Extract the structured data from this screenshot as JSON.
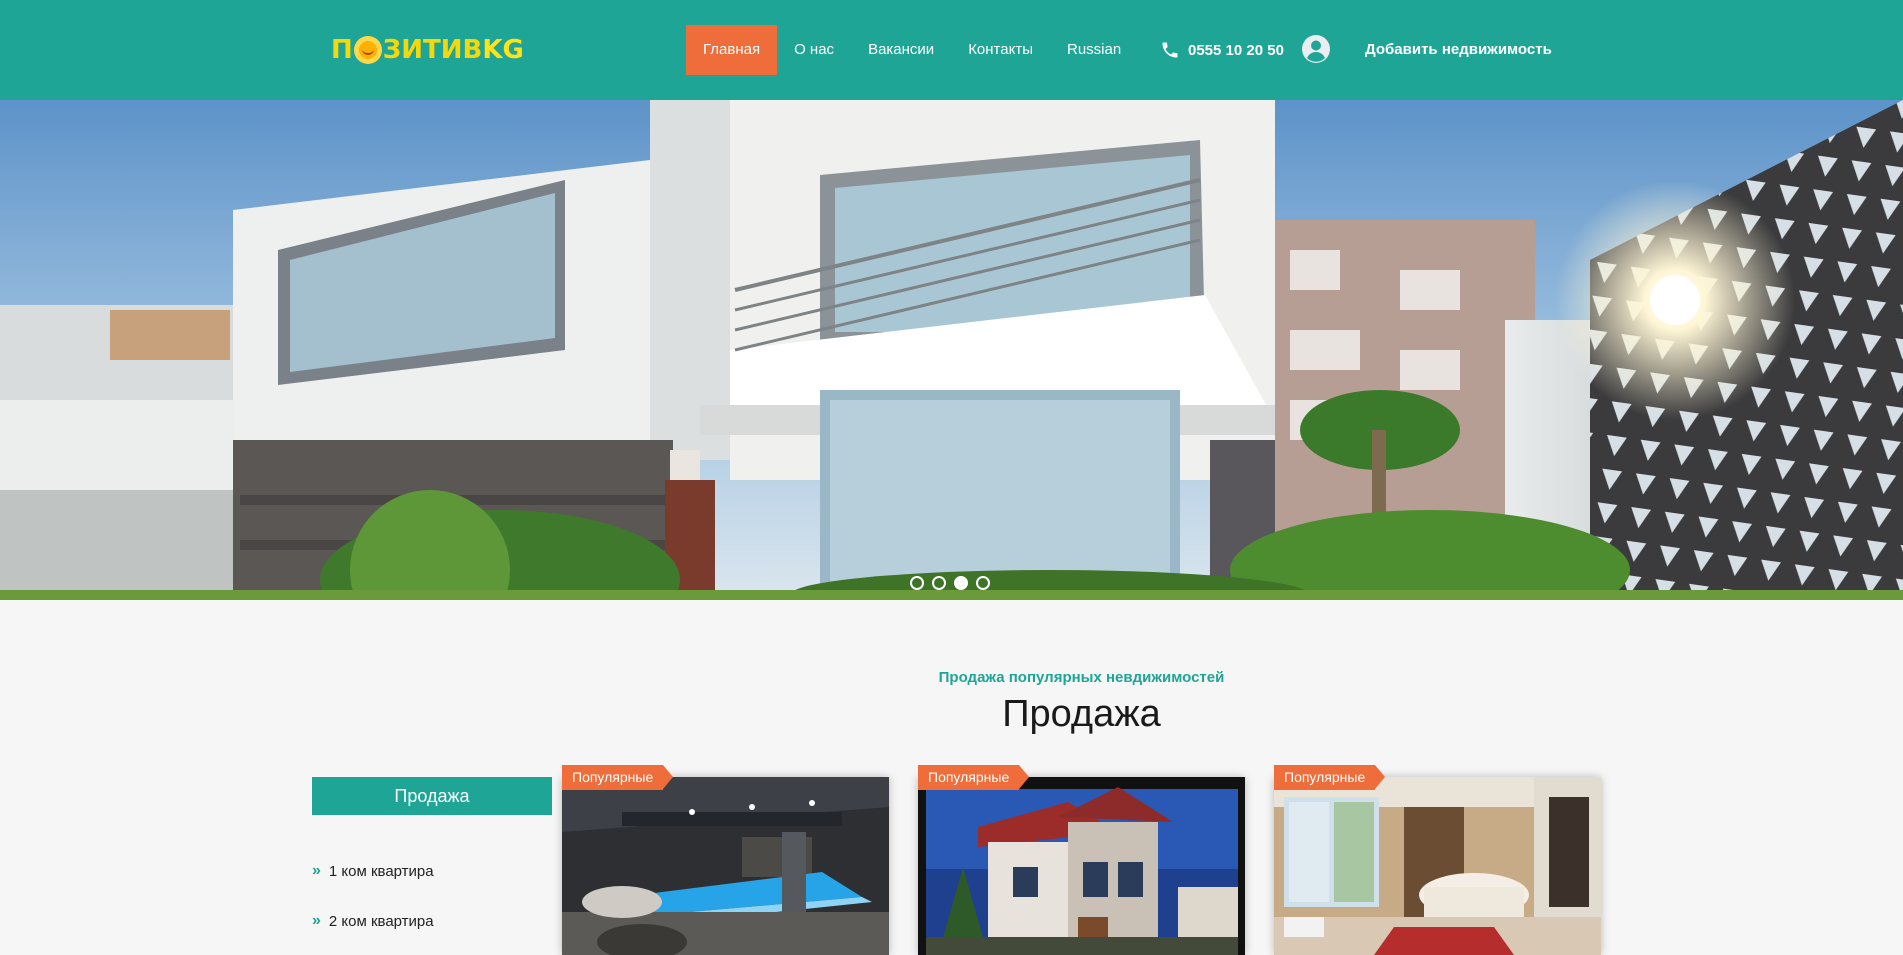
{
  "brand": {
    "logo_text_a": "П",
    "logo_text_b": "ЗИТИВ",
    "logo_text_c": "KG"
  },
  "nav": {
    "items": [
      {
        "label": "Главная",
        "active": true
      },
      {
        "label": "О нас"
      },
      {
        "label": "Вакансии"
      },
      {
        "label": "Контакты"
      },
      {
        "label": "Russian"
      }
    ]
  },
  "header": {
    "phone": "0555 10 20 50",
    "add_property": "Добавить недвижимость"
  },
  "hero": {
    "slides": 4,
    "active_slide": 3
  },
  "section": {
    "subtitle": "Продажа популярных невдижимостей",
    "title": "Продажа"
  },
  "sidebar": {
    "heading": "Продажа",
    "items": [
      {
        "label": "1 ком квартира"
      },
      {
        "label": "2 ком квартира"
      }
    ]
  },
  "cards": [
    {
      "badge": "Популярные"
    },
    {
      "badge": "Популярные"
    },
    {
      "badge": "Популярные"
    }
  ],
  "colors": {
    "primary": "#1fa596",
    "accent": "#ee6d3a",
    "logo_yellow": "#f5d80a"
  }
}
